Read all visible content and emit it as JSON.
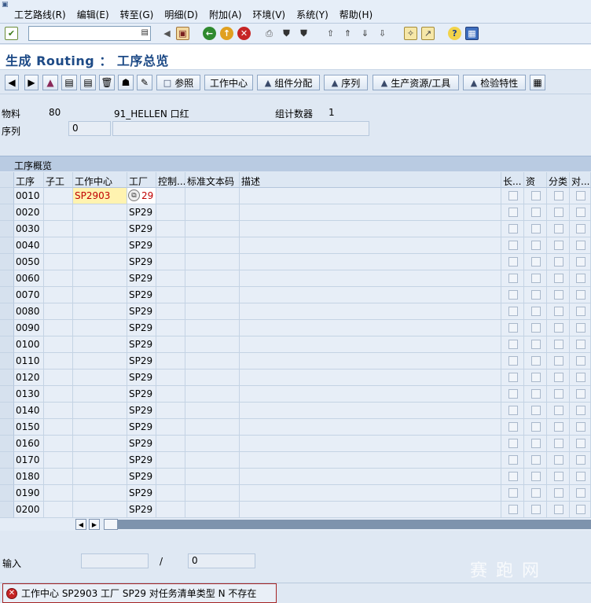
{
  "menu": [
    "工艺路线(R)",
    "编辑(E)",
    "转至(G)",
    "明细(D)",
    "附加(A)",
    "环境(V)",
    "系统(Y)",
    "帮助(H)"
  ],
  "title": "生成 Routing ： 工序总览",
  "app_toolbar": {
    "ref_label": "参照",
    "workcenter_label": "工作中心",
    "component_label": "组件分配",
    "sequence_label": "序列",
    "prt_label": "生产资源/工具",
    "inspection_label": "检验特性"
  },
  "header": {
    "material_label": "物料",
    "material_value": "80",
    "material_desc": "91_HELLEN 口红",
    "group_counter_label": "组计数器",
    "group_counter_value": "1",
    "sequence_label": "序列",
    "sequence_value": "0"
  },
  "table": {
    "panel_title": "工序概览",
    "columns": [
      "工序",
      "子工",
      "工作中心",
      "工厂",
      "控制...",
      "标准文本码",
      "描述",
      "长...",
      "资",
      "分类",
      "对..."
    ],
    "rows": [
      {
        "op": "0010",
        "wc": "SP2903",
        "plant": "29"
      },
      {
        "op": "0020",
        "wc": "",
        "plant": "SP29"
      },
      {
        "op": "0030",
        "wc": "",
        "plant": "SP29"
      },
      {
        "op": "0040",
        "wc": "",
        "plant": "SP29"
      },
      {
        "op": "0050",
        "wc": "",
        "plant": "SP29"
      },
      {
        "op": "0060",
        "wc": "",
        "plant": "SP29"
      },
      {
        "op": "0070",
        "wc": "",
        "plant": "SP29"
      },
      {
        "op": "0080",
        "wc": "",
        "plant": "SP29"
      },
      {
        "op": "0090",
        "wc": "",
        "plant": "SP29"
      },
      {
        "op": "0100",
        "wc": "",
        "plant": "SP29"
      },
      {
        "op": "0110",
        "wc": "",
        "plant": "SP29"
      },
      {
        "op": "0120",
        "wc": "",
        "plant": "SP29"
      },
      {
        "op": "0130",
        "wc": "",
        "plant": "SP29"
      },
      {
        "op": "0140",
        "wc": "",
        "plant": "SP29"
      },
      {
        "op": "0150",
        "wc": "",
        "plant": "SP29"
      },
      {
        "op": "0160",
        "wc": "",
        "plant": "SP29"
      },
      {
        "op": "0170",
        "wc": "",
        "plant": "SP29"
      },
      {
        "op": "0180",
        "wc": "",
        "plant": "SP29"
      },
      {
        "op": "0190",
        "wc": "",
        "plant": "SP29"
      },
      {
        "op": "0200",
        "wc": "",
        "plant": "SP29"
      }
    ]
  },
  "entry": {
    "label": "输入",
    "slash": "/",
    "total_value": "0"
  },
  "status": {
    "message": "工作中心 SP2903 工厂 SP29 对任务清单类型 N 不存在"
  },
  "watermark": "赛 跑 网",
  "colors": {
    "title": "#1d4a86",
    "error": "#c62424",
    "highlight_field": "#fff3b0",
    "error_text": "#c00000"
  }
}
